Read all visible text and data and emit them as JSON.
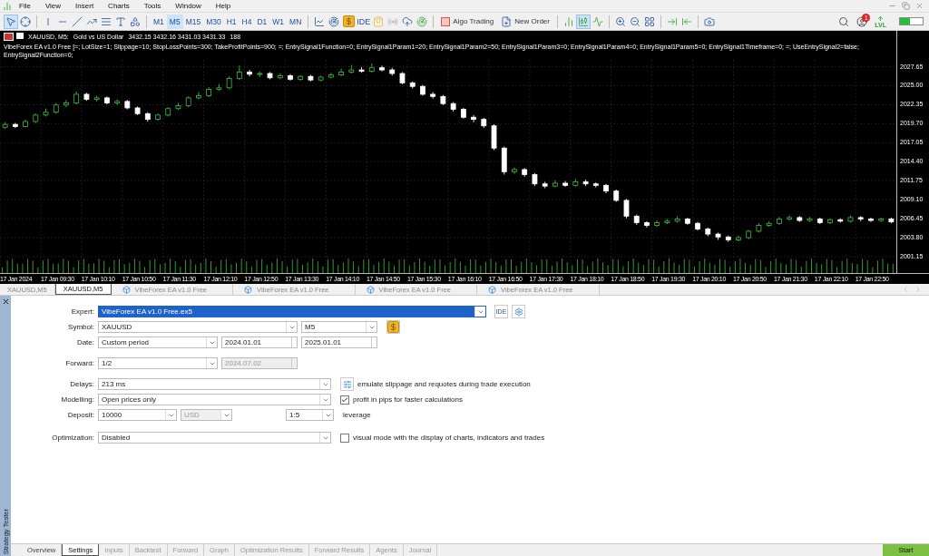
{
  "menu": [
    {
      "label": "File"
    },
    {
      "label": "View"
    },
    {
      "label": "Insert"
    },
    {
      "label": "Charts"
    },
    {
      "label": "Tools"
    },
    {
      "label": "Window"
    },
    {
      "label": "Help"
    }
  ],
  "toolbar": {
    "cursor_selected": true,
    "timeframes": [
      {
        "label": "M1",
        "selected": false
      },
      {
        "label": "M5",
        "selected": true
      },
      {
        "label": "M15",
        "selected": false
      },
      {
        "label": "M30",
        "selected": false
      },
      {
        "label": "H1",
        "selected": false
      },
      {
        "label": "H4",
        "selected": false
      },
      {
        "label": "D1",
        "selected": false
      },
      {
        "label": "W1",
        "selected": false
      },
      {
        "label": "MN",
        "selected": false
      }
    ],
    "ide_label": "IDE",
    "algo_trading": "Algo Trading",
    "new_order": "New Order",
    "chart_types": [
      {
        "kind": "bars",
        "selected": false
      },
      {
        "kind": "candles",
        "selected": true
      },
      {
        "kind": "line",
        "selected": false
      }
    ],
    "notification_count": "1",
    "level_label": "LVL",
    "meter": {
      "level": 0.45
    }
  },
  "chart": {
    "symbol": "XAUUSD, M5:",
    "description": "Gold vs US Dollar",
    "prices": "3432.15 3432.16 3431.03 3431.33",
    "volume": "188",
    "ea_line": "VibeForex EA v1.0 Free [=; LotSize=1; Slippage=10; StopLossPoints=300; TakeProfitPoints=900; =; EntrySignal1Function=0; EntrySignal1Param1=20; EntrySignal1Param2=50; EntrySignal1Param3=0; EntrySignal1Param4=0; EntrySignal1Param5=0; EntrySignal1Timeframe=0; =; UseEntrySignal2=false; EntrySignal2Function=0;",
    "time_labels": [
      "17 Jan 2024",
      "17 Jan 09:30",
      "17 Jan 10:10",
      "17 Jan 10:50",
      "17 Jan 11:30",
      "17 Jan 12:10",
      "17 Jan 12:50",
      "17 Jan 13:30",
      "17 Jan 14:10",
      "17 Jan 14:50",
      "17 Jan 15:30",
      "17 Jan 16:10",
      "17 Jan 16:50",
      "17 Jan 17:30",
      "17 Jan 18:10",
      "17 Jan 18:50",
      "17 Jan 19:30",
      "17 Jan 20:10",
      "17 Jan 20:50",
      "17 Jan 21:30",
      "17 Jan 22:10",
      "17 Jan 22:50"
    ],
    "chart_data": {
      "type": "candlestick",
      "ylim": [
        1998.87,
        2032.65
      ],
      "grid": true,
      "yticks": [
        {
          "value": 2027.65,
          "label": "2027.65"
        },
        {
          "value": 2025,
          "label": "2025.00"
        },
        {
          "value": 2022.35,
          "label": "2022.35"
        },
        {
          "value": 2019.7,
          "label": "2019.70"
        },
        {
          "value": 2017.05,
          "label": "2017.05"
        },
        {
          "value": 2014.4,
          "label": "2014.40"
        },
        {
          "value": 2011.75,
          "label": "2011.75"
        },
        {
          "value": 2009.1,
          "label": "2009.10"
        },
        {
          "value": 2006.45,
          "label": "2006.45"
        },
        {
          "value": 2003.8,
          "label": "2003.80"
        },
        {
          "value": 2001.15,
          "label": "2001.15"
        }
      ],
      "ohlc": [
        [
          2019.2,
          2019.9,
          2019.0,
          2019.6
        ],
        [
          2019.6,
          2019.8,
          2019.1,
          2019.3
        ],
        [
          2019.3,
          2020.3,
          2019.2,
          2020.0
        ],
        [
          2020.0,
          2021.1,
          2019.8,
          2020.9
        ],
        [
          2020.9,
          2021.8,
          2020.7,
          2021.3
        ],
        [
          2021.3,
          2022.6,
          2021.1,
          2022.3
        ],
        [
          2022.3,
          2023.0,
          2022.0,
          2022.6
        ],
        [
          2022.6,
          2024.2,
          2022.4,
          2023.8
        ],
        [
          2023.8,
          2024.0,
          2022.9,
          2023.1
        ],
        [
          2023.1,
          2023.6,
          2022.8,
          2023.3
        ],
        [
          2023.3,
          2023.5,
          2022.4,
          2022.6
        ],
        [
          2022.6,
          2023.1,
          2022.3,
          2022.8
        ],
        [
          2022.8,
          2023.0,
          2021.7,
          2021.9
        ],
        [
          2021.9,
          2022.1,
          2020.9,
          2021.1
        ],
        [
          2021.1,
          2021.3,
          2020.0,
          2020.3
        ],
        [
          2020.3,
          2021.1,
          2020.1,
          2020.9
        ],
        [
          2020.9,
          2022.0,
          2020.7,
          2021.8
        ],
        [
          2021.8,
          2022.6,
          2021.6,
          2022.2
        ],
        [
          2022.2,
          2023.5,
          2022.0,
          2023.3
        ],
        [
          2023.3,
          2024.1,
          2023.1,
          2023.6
        ],
        [
          2023.6,
          2024.8,
          2023.4,
          2024.5
        ],
        [
          2024.5,
          2025.2,
          2024.3,
          2024.7
        ],
        [
          2024.7,
          2026.3,
          2024.5,
          2026.0
        ],
        [
          2026.0,
          2027.8,
          2025.8,
          2026.9
        ],
        [
          2026.9,
          2027.2,
          2026.3,
          2026.6
        ],
        [
          2026.6,
          2027.0,
          2026.2,
          2026.7
        ],
        [
          2026.7,
          2026.9,
          2025.9,
          2026.1
        ],
        [
          2026.1,
          2026.7,
          2025.9,
          2026.4
        ],
        [
          2026.4,
          2026.6,
          2025.7,
          2025.9
        ],
        [
          2025.9,
          2026.5,
          2025.7,
          2026.3
        ],
        [
          2026.3,
          2026.5,
          2025.6,
          2025.8
        ],
        [
          2025.8,
          2026.4,
          2025.6,
          2026.2
        ],
        [
          2026.2,
          2026.8,
          2026.0,
          2026.5
        ],
        [
          2026.5,
          2027.4,
          2026.3,
          2026.9
        ],
        [
          2026.9,
          2027.9,
          2026.7,
          2027.2
        ],
        [
          2027.2,
          2027.6,
          2026.8,
          2027.0
        ],
        [
          2027.0,
          2028.1,
          2026.8,
          2027.5
        ],
        [
          2027.5,
          2027.8,
          2027.0,
          2027.2
        ],
        [
          2027.2,
          2027.5,
          2026.4,
          2026.7
        ],
        [
          2026.7,
          2026.9,
          2025.2,
          2025.4
        ],
        [
          2025.4,
          2025.6,
          2024.6,
          2024.9
        ],
        [
          2024.9,
          2025.1,
          2023.6,
          2023.8
        ],
        [
          2023.8,
          2024.1,
          2023.2,
          2023.5
        ],
        [
          2023.5,
          2023.7,
          2022.3,
          2022.5
        ],
        [
          2022.5,
          2022.7,
          2021.4,
          2021.7
        ],
        [
          2021.7,
          2021.9,
          2020.4,
          2020.6
        ],
        [
          2020.6,
          2020.9,
          2019.9,
          2020.3
        ],
        [
          2020.3,
          2020.5,
          2019.1,
          2019.4
        ],
        [
          2019.4,
          2019.6,
          2016.0,
          2016.3
        ],
        [
          2016.3,
          2016.5,
          2012.6,
          2013.0
        ],
        [
          2013.0,
          2013.6,
          2012.7,
          2013.3
        ],
        [
          2013.3,
          2013.5,
          2012.3,
          2012.6
        ],
        [
          2012.6,
          2012.8,
          2011.0,
          2011.3
        ],
        [
          2011.3,
          2011.6,
          2010.7,
          2011.0
        ],
        [
          2011.0,
          2011.8,
          2010.8,
          2011.4
        ],
        [
          2011.4,
          2011.7,
          2010.9,
          2011.1
        ],
        [
          2011.1,
          2012.0,
          2010.9,
          2011.6
        ],
        [
          2011.6,
          2011.9,
          2011.0,
          2011.3
        ],
        [
          2011.3,
          2011.5,
          2010.8,
          2011.1
        ],
        [
          2011.1,
          2011.3,
          2010.0,
          2010.3
        ],
        [
          2010.3,
          2010.5,
          2008.8,
          2009.0
        ],
        [
          2009.0,
          2009.2,
          2006.5,
          2006.8
        ],
        [
          2006.8,
          2007.0,
          2005.6,
          2005.9
        ],
        [
          2005.9,
          2006.1,
          2005.2,
          2005.5
        ],
        [
          2005.5,
          2006.2,
          2005.3,
          2005.9
        ],
        [
          2005.9,
          2006.4,
          2005.7,
          2006.1
        ],
        [
          2006.1,
          2006.8,
          2005.9,
          2006.4
        ],
        [
          2006.4,
          2006.6,
          2005.6,
          2005.8
        ],
        [
          2005.8,
          2006.0,
          2004.8,
          2005.0
        ],
        [
          2005.0,
          2005.2,
          2004.0,
          2004.3
        ],
        [
          2004.3,
          2004.5,
          2003.5,
          2003.9
        ],
        [
          2003.9,
          2004.1,
          2003.2,
          2003.5
        ],
        [
          2003.5,
          2004.1,
          2003.3,
          2003.8
        ],
        [
          2003.8,
          2004.9,
          2003.6,
          2004.7
        ],
        [
          2004.7,
          2005.8,
          2004.5,
          2005.5
        ],
        [
          2005.5,
          2006.1,
          2005.3,
          2005.8
        ],
        [
          2005.8,
          2006.7,
          2005.6,
          2006.4
        ],
        [
          2006.4,
          2006.9,
          2006.2,
          2006.6
        ],
        [
          2006.6,
          2006.8,
          2006.0,
          2006.2
        ],
        [
          2006.2,
          2006.7,
          2006.0,
          2006.4
        ],
        [
          2006.4,
          2006.6,
          2005.7,
          2005.9
        ],
        [
          2005.9,
          2006.5,
          2005.7,
          2006.3
        ],
        [
          2006.3,
          2006.5,
          2005.9,
          2006.1
        ],
        [
          2006.1,
          2006.9,
          2005.9,
          2006.6
        ],
        [
          2006.6,
          2006.8,
          2006.1,
          2006.4
        ],
        [
          2006.4,
          2006.6,
          2006.0,
          2006.2
        ],
        [
          2006.2,
          2006.6,
          2006.0,
          2006.4
        ],
        [
          2006.4,
          2006.6,
          2005.8,
          2006.0
        ]
      ]
    }
  },
  "chart_tabs": [
    {
      "label": "XAUUSD,M5",
      "kind": "chart",
      "selected": false
    },
    {
      "label": "XAUUSD,M5",
      "kind": "chart",
      "selected": true
    },
    {
      "label": "VibeForex EA v1.0 Free",
      "kind": "ea",
      "selected": false
    },
    {
      "label": "VibeForex EA v1.0 Free",
      "kind": "ea",
      "selected": false
    },
    {
      "label": "VibeForex EA v1.0 Free",
      "kind": "ea",
      "selected": false
    },
    {
      "label": "VibeForex EA v1.0 Free",
      "kind": "ea",
      "selected": false
    }
  ],
  "tester": {
    "title": "Strategy Tester",
    "expert": {
      "label": "Expert:",
      "value": "VibeForex EA v1.0 Free.ex5",
      "focused": true,
      "ide_label": "IDE"
    },
    "symbol": {
      "label": "Symbol:",
      "value": "XAUUSD",
      "timeframe": "M5"
    },
    "date": {
      "label": "Date:",
      "value": "Custom period",
      "from": "2024.01.01",
      "to": "2025.01.01"
    },
    "forward": {
      "label": "Forward:",
      "value": "1/2",
      "date": "2024.07.02",
      "date_disabled": true
    },
    "delays": {
      "label": "Delays:",
      "value": "213 ms",
      "note": "emulate slippage and requotes during trade execution"
    },
    "modelling": {
      "label": "Modelling:",
      "value": "Open prices only",
      "option": "profit in pips for faster calculations",
      "checked": true
    },
    "deposit": {
      "label": "Deposit:",
      "value": "10000",
      "currency": "USD",
      "currency_disabled": true,
      "leverage": "1:5",
      "leverage_label": "leverage"
    },
    "optimization": {
      "label": "Optimization:",
      "value": "Disabled",
      "option": "visual mode with the display of charts, indicators and trades",
      "checked": false
    }
  },
  "bottom_tabs": [
    {
      "label": "Overview",
      "selected": false,
      "disabled": false
    },
    {
      "label": "Settings",
      "selected": true,
      "disabled": false
    },
    {
      "label": "Inputs",
      "selected": false,
      "disabled": true
    },
    {
      "label": "Backtest",
      "selected": false,
      "disabled": true
    },
    {
      "label": "Forward",
      "selected": false,
      "disabled": true
    },
    {
      "label": "Graph",
      "selected": false,
      "disabled": true
    },
    {
      "label": "Optimization Results",
      "selected": false,
      "disabled": true
    },
    {
      "label": "Forward Results",
      "selected": false,
      "disabled": true
    },
    {
      "label": "Agents",
      "selected": false,
      "disabled": true
    },
    {
      "label": "Journal",
      "selected": false,
      "disabled": true
    }
  ],
  "start_button": "Start"
}
